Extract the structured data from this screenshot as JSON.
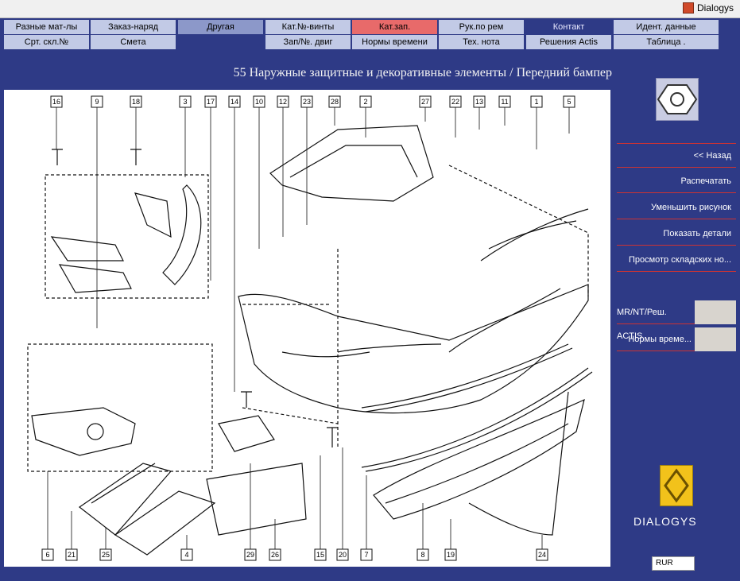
{
  "window": {
    "title": "Dialogys"
  },
  "tabs_top": [
    {
      "label": "Разные мат-лы"
    },
    {
      "label": "Заказ-наряд"
    },
    {
      "label": "Другая"
    },
    {
      "label": "Кат.№-винты"
    },
    {
      "label": "Кат.зап."
    },
    {
      "label": "Рук.по рем"
    },
    {
      "label": "Контакт"
    },
    {
      "label": "Идент. данные"
    }
  ],
  "tabs_bottom": [
    {
      "label": "Срт. скл.№"
    },
    {
      "label": "Смета"
    },
    {
      "label": "Зап/№. двиг"
    },
    {
      "label": "Нормы времени"
    },
    {
      "label": "Тех. нота"
    },
    {
      "label": "Решения Actis"
    },
    {
      "label": "Таблица ."
    }
  ],
  "heading": "55 Наружные защитные и декоративные элементы / Передний бампер",
  "side_menu": [
    {
      "label": "<< Назад"
    },
    {
      "label": "Распечатать"
    },
    {
      "label": "Уменьшить рисунок"
    },
    {
      "label": "Показать детали"
    },
    {
      "label": "Просмотр складских но..."
    }
  ],
  "side_tools": [
    {
      "label": "MR/NT/Реш. ACTIS"
    },
    {
      "label": "Нормы време..."
    }
  ],
  "brand": "DIALOGYS",
  "flag_label": "RUR",
  "callouts_top": [
    "16",
    "9",
    "18",
    "3",
    "17",
    "14",
    "10",
    "12",
    "23",
    "28",
    "2",
    "27",
    "22",
    "13",
    "11",
    "1",
    "5"
  ],
  "callouts_bottom": [
    "6",
    "21",
    "25",
    "4",
    "29",
    "26",
    "15",
    "20",
    "7",
    "8",
    "19",
    "24"
  ]
}
